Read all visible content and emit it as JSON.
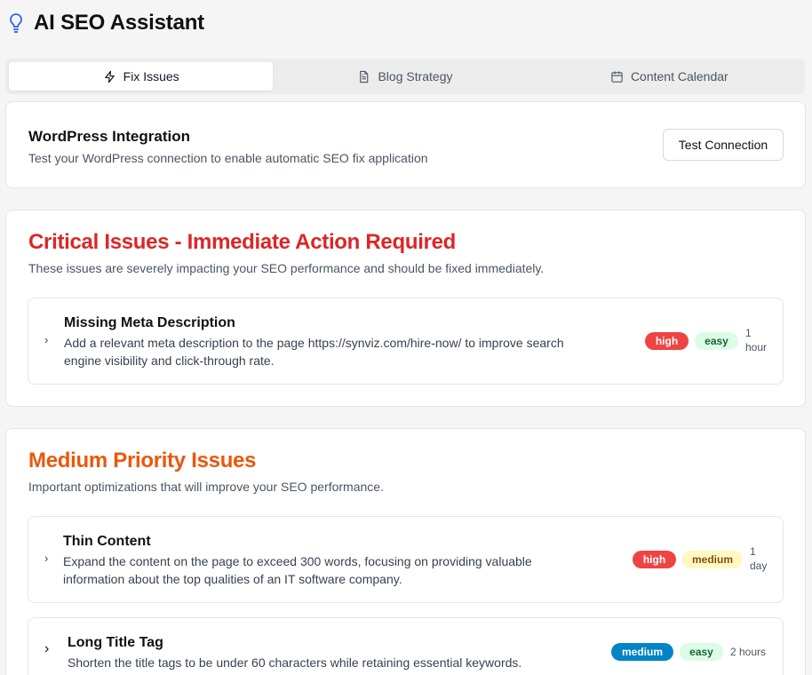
{
  "app": {
    "title": "AI SEO Assistant",
    "icon": "lightbulb-icon"
  },
  "tabs": [
    {
      "label": "Fix Issues",
      "icon": "lightning-icon",
      "active": true
    },
    {
      "label": "Blog Strategy",
      "icon": "document-icon",
      "active": false
    },
    {
      "label": "Content Calendar",
      "icon": "calendar-icon",
      "active": false
    }
  ],
  "wordpress": {
    "title": "WordPress Integration",
    "description": "Test your WordPress connection to enable automatic SEO fix application",
    "button_label": "Test Connection"
  },
  "critical": {
    "title": "Critical Issues - Immediate Action Required",
    "description": "These issues are severely impacting your SEO performance and should be fixed immediately.",
    "color": "#dc2626",
    "issues": [
      {
        "title": "Missing Meta Description",
        "description_line1": "Add a relevant meta description to the page https://synviz.com/hire-now/ to improve search",
        "description_line2": "engine visibility and click-through rate.",
        "impact": "high",
        "effort": "easy",
        "time_line1": "1",
        "time_line2": "hour"
      }
    ]
  },
  "medium": {
    "title": "Medium Priority Issues",
    "description": "Important optimizations that will improve your SEO performance.",
    "color": "#ea580c",
    "issues": [
      {
        "title": "Thin Content",
        "description_line1": "Expand the content on the page to exceed 300 words, focusing on providing valuable",
        "description_line2": "information about the top qualities of an IT software company.",
        "impact": "high",
        "effort": "medium",
        "time_line1": "1",
        "time_line2": "day"
      },
      {
        "title": "Long Title Tag",
        "description_line1": "Shorten the title tags to be under 60 characters while retaining essential keywords.",
        "impact": "medium",
        "effort": "easy",
        "time": "2 hours"
      }
    ]
  },
  "colors": {
    "high": "#ef4444",
    "easy_bg": "#dcfce7",
    "medium_effort_bg": "#fef9c3",
    "medium_impact": "#0284c7"
  }
}
